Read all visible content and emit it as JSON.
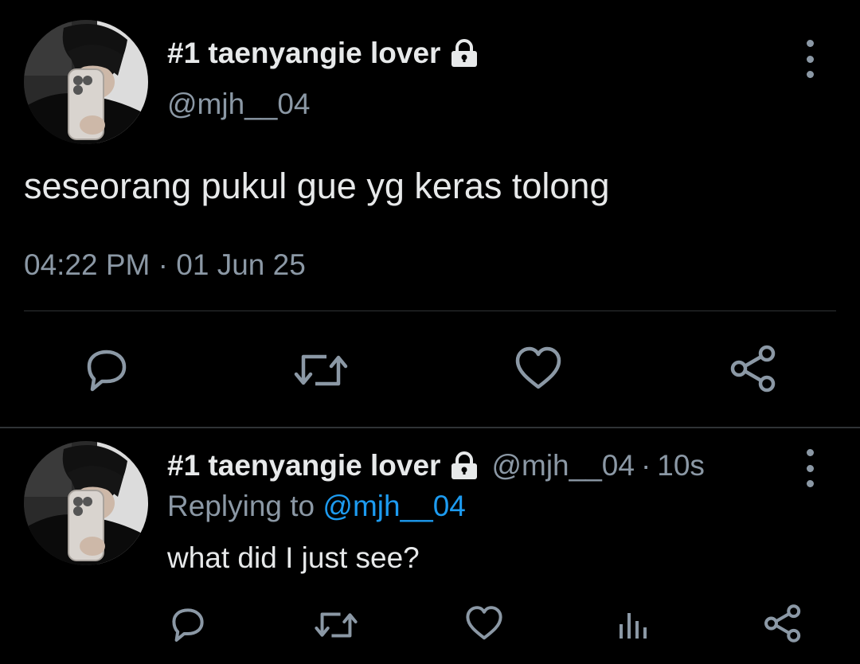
{
  "main_tweet": {
    "display_name": "#1 taenyangie lover",
    "handle": "@mjh__04",
    "text": "seseorang pukul gue yg keras tolong",
    "time": "04:22 PM",
    "separator": "·",
    "date": "01 Jun 25",
    "actions": [
      "reply-icon",
      "retweet-icon",
      "like-icon",
      "share-icon"
    ]
  },
  "reply_tweet": {
    "display_name": "#1 taenyangie lover",
    "handle": "@mjh__04",
    "separator": "·",
    "age": "10s",
    "replying_prefix": "Replying to",
    "replying_to": "@mjh__04",
    "text": "what did I just see?",
    "actions": [
      "reply-icon",
      "retweet-icon",
      "like-icon",
      "analytics-icon",
      "share-icon"
    ]
  },
  "colors": {
    "background": "#000000",
    "primary_text": "#e7e9ea",
    "secondary_text": "#8b98a5",
    "link": "#1d9bf0",
    "divider": "#2f3336"
  }
}
